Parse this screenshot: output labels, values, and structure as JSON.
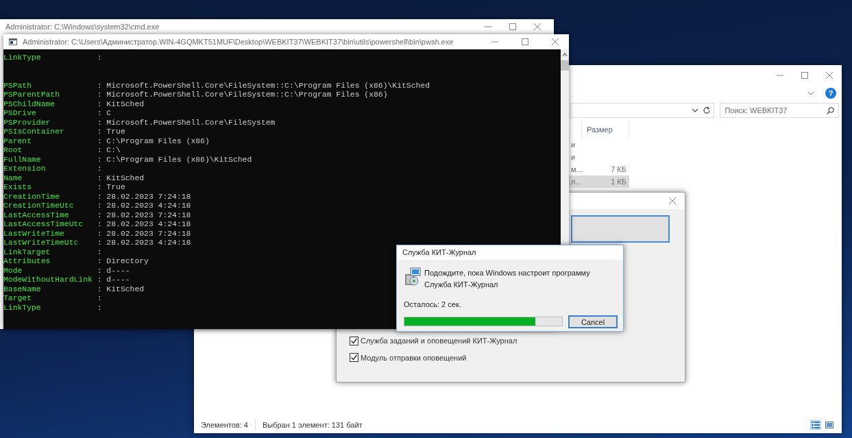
{
  "cmd_window": {
    "title": "Administrator: C:\\Windows\\system32\\cmd.exe"
  },
  "explorer_window": {
    "help_button": "?",
    "search": {
      "placeholder": "Поиск: WEBKIT37"
    },
    "columns": [
      "Размер"
    ],
    "rows": [
      {
        "column_1": "и",
        "selected": false
      },
      {
        "column_1": "и",
        "selected": false
      },
      {
        "column_1": "м...",
        "size": "7 КБ",
        "selected": false
      },
      {
        "column_1": "л...",
        "size": "1 КБ",
        "selected": true
      }
    ],
    "status_bar": {
      "item_count": "Элементов: 4",
      "selection_info": "Выбран 1 элемент: 131 байт"
    },
    "view_buttons": [
      {
        "kind": "details",
        "selected": true
      },
      {
        "kind": "thumbnails",
        "selected": false
      }
    ]
  },
  "setup_window": {
    "options": [
      {
        "label": "Служба заданий и оповещений КИТ-Журнал",
        "checked": true
      },
      {
        "label": "Модуль отправки оповещений",
        "checked": true
      }
    ]
  },
  "powershell_window": {
    "title": "Administrator: C:\\Users\\Администратор.WIN-4GQMKT51MUF\\Desktop\\WEBKIT37\\WEBKIT37\\bin\\utils\\powershell\\bin\\pwsh.exe",
    "lines": [
      {
        "kind": "property",
        "name": "LinkType",
        "value": ":"
      },
      {
        "kind": "blank"
      },
      {
        "kind": "blank"
      },
      {
        "kind": "property",
        "name": "PSPath",
        "value": ": Microsoft.PowerShell.Core\\FileSystem::C:\\Program Files (x86)\\KitSched"
      },
      {
        "kind": "property",
        "name": "PSParentPath",
        "value": ": Microsoft.PowerShell.Core\\FileSystem::C:\\Program Files (x86)"
      },
      {
        "kind": "property",
        "name": "PSChildName",
        "value": ": KitSched"
      },
      {
        "kind": "property",
        "name": "PSDrive",
        "value": ": C"
      },
      {
        "kind": "property",
        "name": "PSProvider",
        "value": ": Microsoft.PowerShell.Core\\FileSystem"
      },
      {
        "kind": "property",
        "name": "PSIsContainer",
        "value": ": True"
      },
      {
        "kind": "property",
        "name": "Parent",
        "value": ": C:\\Program Files (x86)"
      },
      {
        "kind": "property",
        "name": "Root",
        "value": ": C:\\"
      },
      {
        "kind": "property",
        "name": "FullName",
        "value": ": C:\\Program Files (x86)\\KitSched"
      },
      {
        "kind": "property",
        "name": "Extension",
        "value": ":"
      },
      {
        "kind": "property",
        "name": "Name",
        "value": ": KitSched"
      },
      {
        "kind": "property",
        "name": "Exists",
        "value": ": True"
      },
      {
        "kind": "property",
        "name": "CreationTime",
        "value": ": 28.02.2023 7:24:18"
      },
      {
        "kind": "property",
        "name": "CreationTimeUtc",
        "value": ": 28.02.2023 4:24:18"
      },
      {
        "kind": "property",
        "name": "LastAccessTime",
        "value": ": 28.02.2023 7:24:18"
      },
      {
        "kind": "property",
        "name": "LastAccessTimeUtc",
        "value": ": 28.02.2023 4:24:18"
      },
      {
        "kind": "property",
        "name": "LastWriteTime",
        "value": ": 28.02.2023 7:24:18"
      },
      {
        "kind": "property",
        "name": "LastWriteTimeUtc",
        "value": ": 28.02.2023 4:24:18"
      },
      {
        "kind": "property",
        "name": "LinkTarget",
        "value": ":"
      },
      {
        "kind": "property",
        "name": "Attributes",
        "value": ": Directory"
      },
      {
        "kind": "property",
        "name": "Mode",
        "value": ": d----"
      },
      {
        "kind": "property",
        "name": "ModeWithoutHardLink",
        "value": ": d----"
      },
      {
        "kind": "property",
        "name": "BaseName",
        "value": ": KitSched"
      },
      {
        "kind": "property",
        "name": "Target",
        "value": ":"
      },
      {
        "kind": "property",
        "name": "LinkType",
        "value": ":"
      }
    ]
  },
  "progress_dialog": {
    "title": "Служба КИТ-Журнал",
    "message": "Подождите, пока Windows настроит программу Служба КИТ-Журнал",
    "remaining": "Осталось: 2 сек.",
    "level": 0.83,
    "cancel_button": "Cancel"
  }
}
